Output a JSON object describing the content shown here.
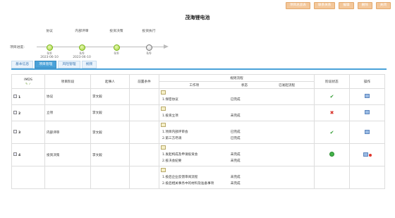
{
  "toolbar": {
    "buttons": [
      "项目总览表",
      "联系关系",
      "编辑",
      "删除",
      "关闭"
    ]
  },
  "project": {
    "title": "茂海锂电池"
  },
  "progress": {
    "label": "项目进度:",
    "steps": [
      {
        "name": "协议",
        "ratio": "0/0",
        "date": "2023-06-10",
        "state": "done"
      },
      {
        "name": "内部评审",
        "ratio": "0/0",
        "date": "2023-06-10",
        "state": "done"
      },
      {
        "name": "投资决策",
        "ratio": "0/0",
        "date": "",
        "state": "done"
      },
      {
        "name": "投资执行",
        "ratio": "0/0",
        "date": "",
        "state": "pending"
      }
    ]
  },
  "tabs": [
    {
      "label": "基本信息",
      "active": false
    },
    {
      "label": "项目管理",
      "active": true
    },
    {
      "label": "风险管理",
      "active": false
    },
    {
      "label": "视频",
      "active": false
    }
  ],
  "table": {
    "headers": {
      "ids": "IMDS",
      "stage": "项目阶段",
      "initiator": "起事人",
      "precondition": "前置条件",
      "flow": "规则流程",
      "work_item": "工作项",
      "status": "状态",
      "approver": "已发起流程",
      "stage_status": "阶段状态",
      "ops": "操作"
    },
    "rows": [
      {
        "no": "1",
        "stage": "协议",
        "person": "李文毅",
        "items": [
          {
            "name": "1.保密协议",
            "status": "已完成"
          }
        ],
        "state": "ok",
        "ops": [
          "doc"
        ]
      },
      {
        "no": "2",
        "stage": "立项",
        "person": "李文毅",
        "items": [
          {
            "name": "1.投资立项",
            "status": "未完成"
          }
        ],
        "state": "fail",
        "ops": [
          "doc"
        ]
      },
      {
        "no": "3",
        "stage": "内部评审",
        "person": "李文毅",
        "items": [
          {
            "name": "1.项目内部评审会",
            "status": "已完成"
          },
          {
            "name": "2.第三方尽调",
            "status": "已完成"
          }
        ],
        "state": "ok",
        "ops": [
          "doc"
        ]
      },
      {
        "no": "4",
        "stage": "投资决策",
        "person": "李文毅",
        "items": [
          {
            "name": "1.发起构成及申请投资会",
            "status": "未完成"
          },
          {
            "name": "2.投决会纪要",
            "status": "未完成"
          }
        ],
        "state": "progress",
        "ops": [
          "doc",
          "delete"
        ]
      },
      {
        "no": "",
        "stage": "",
        "person": "",
        "items": [
          {
            "name": "1.投后企业反馈审阅流程",
            "status": "未完成"
          },
          {
            "name": "2.投后相关事务中的材料及准备事项",
            "status": "未完成"
          }
        ],
        "state": "",
        "ops": []
      }
    ]
  }
}
